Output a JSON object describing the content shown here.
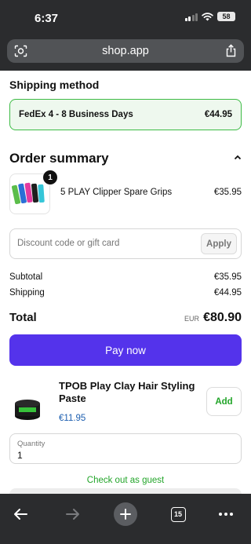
{
  "status": {
    "time": "6:37",
    "battery": "58"
  },
  "browser": {
    "url": "shop.app"
  },
  "shipping": {
    "heading": "Shipping method",
    "option_name": "FedEx 4 - 8 Business Days",
    "option_price": "€44.95"
  },
  "order": {
    "heading": "Order summary",
    "item": {
      "quantity": "1",
      "name": "5 PLAY Clipper Spare Grips",
      "price": "€35.95"
    }
  },
  "discount": {
    "placeholder": "Discount code or gift card",
    "apply_label": "Apply"
  },
  "summary": {
    "subtotal_label": "Subtotal",
    "subtotal_value": "€35.95",
    "shipping_label": "Shipping",
    "shipping_value": "€44.95",
    "total_label": "Total",
    "total_currency": "EUR",
    "total_value": "€80.90"
  },
  "pay_label": "Pay now",
  "recommendation": {
    "name": "TPOB Play Clay Hair Styling Paste",
    "price": "€11.95",
    "add_label": "Add"
  },
  "quantity": {
    "label": "Quantity",
    "value": "1"
  },
  "guest_label": "Check out as guest",
  "toolbar": {
    "tab_count": "15"
  },
  "colors": {
    "accent_purple": "#5433eb",
    "success_green": "#3dbb45",
    "link_blue": "#1d5fb0",
    "chrome": "#2b2c2e"
  }
}
